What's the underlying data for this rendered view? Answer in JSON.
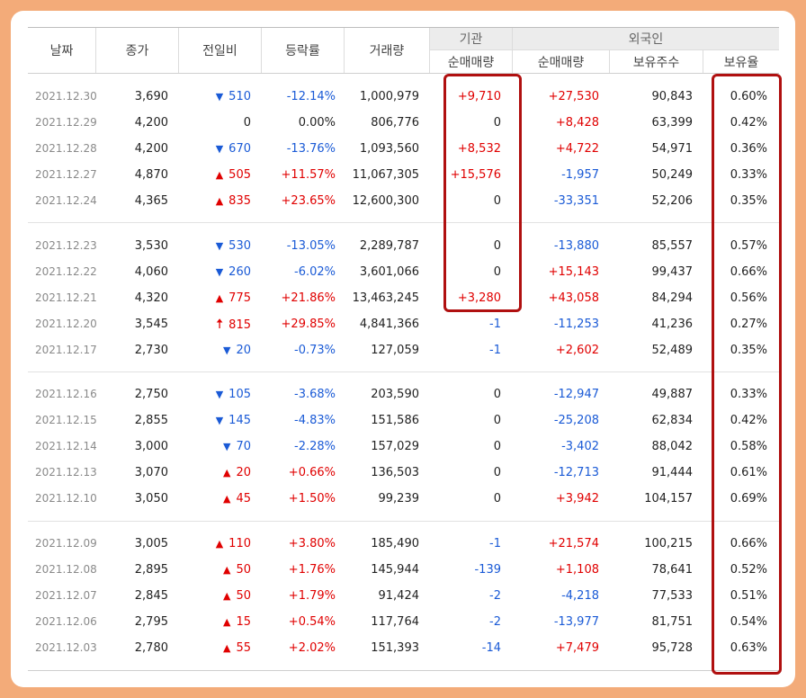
{
  "headers": {
    "date": "날짜",
    "close": "종가",
    "change": "전일비",
    "rate": "등락률",
    "volume": "거래량",
    "institution": "기관",
    "foreigner": "외국인",
    "inst_net": "순매매량",
    "foreign_net": "순매매량",
    "foreign_holdings": "보유주수",
    "foreign_ratio": "보유율"
  },
  "colors": {
    "up": "#e00000",
    "down": "#1a5ad6",
    "highlight": "#b01010",
    "frame": "#f3ab79"
  },
  "rows": [
    {
      "date": "2021.12.30",
      "close": "3,690",
      "dir": "down",
      "change": "510",
      "rate": "-12.14%",
      "volume": "1,000,979",
      "inst": "+9,710",
      "fnet": "+27,530",
      "fhold": "90,843",
      "fratio": "0.60%"
    },
    {
      "date": "2021.12.29",
      "close": "4,200",
      "dir": "none",
      "change": "0",
      "rate": "0.00%",
      "volume": "806,776",
      "inst": "0",
      "fnet": "+8,428",
      "fhold": "63,399",
      "fratio": "0.42%"
    },
    {
      "date": "2021.12.28",
      "close": "4,200",
      "dir": "down",
      "change": "670",
      "rate": "-13.76%",
      "volume": "1,093,560",
      "inst": "+8,532",
      "fnet": "+4,722",
      "fhold": "54,971",
      "fratio": "0.36%"
    },
    {
      "date": "2021.12.27",
      "close": "4,870",
      "dir": "up",
      "change": "505",
      "rate": "+11.57%",
      "volume": "11,067,305",
      "inst": "+15,576",
      "fnet": "-1,957",
      "fhold": "50,249",
      "fratio": "0.33%"
    },
    {
      "date": "2021.12.24",
      "close": "4,365",
      "dir": "up",
      "change": "835",
      "rate": "+23.65%",
      "volume": "12,600,300",
      "inst": "0",
      "fnet": "-33,351",
      "fhold": "52,206",
      "fratio": "0.35%"
    },
    {
      "date": "2021.12.23",
      "close": "3,530",
      "dir": "down",
      "change": "530",
      "rate": "-13.05%",
      "volume": "2,289,787",
      "inst": "0",
      "fnet": "-13,880",
      "fhold": "85,557",
      "fratio": "0.57%"
    },
    {
      "date": "2021.12.22",
      "close": "4,060",
      "dir": "down",
      "change": "260",
      "rate": "-6.02%",
      "volume": "3,601,066",
      "inst": "0",
      "fnet": "+15,143",
      "fhold": "99,437",
      "fratio": "0.66%"
    },
    {
      "date": "2021.12.21",
      "close": "4,320",
      "dir": "up",
      "change": "775",
      "rate": "+21.86%",
      "volume": "13,463,245",
      "inst": "+3,280",
      "fnet": "+43,058",
      "fhold": "84,294",
      "fratio": "0.56%"
    },
    {
      "date": "2021.12.20",
      "close": "3,545",
      "dir": "upper",
      "change": "815",
      "rate": "+29.85%",
      "volume": "4,841,366",
      "inst": "-1",
      "fnet": "-11,253",
      "fhold": "41,236",
      "fratio": "0.27%"
    },
    {
      "date": "2021.12.17",
      "close": "2,730",
      "dir": "down",
      "change": "20",
      "rate": "-0.73%",
      "volume": "127,059",
      "inst": "-1",
      "fnet": "+2,602",
      "fhold": "52,489",
      "fratio": "0.35%"
    },
    {
      "date": "2021.12.16",
      "close": "2,750",
      "dir": "down",
      "change": "105",
      "rate": "-3.68%",
      "volume": "203,590",
      "inst": "0",
      "fnet": "-12,947",
      "fhold": "49,887",
      "fratio": "0.33%"
    },
    {
      "date": "2021.12.15",
      "close": "2,855",
      "dir": "down",
      "change": "145",
      "rate": "-4.83%",
      "volume": "151,586",
      "inst": "0",
      "fnet": "-25,208",
      "fhold": "62,834",
      "fratio": "0.42%"
    },
    {
      "date": "2021.12.14",
      "close": "3,000",
      "dir": "down",
      "change": "70",
      "rate": "-2.28%",
      "volume": "157,029",
      "inst": "0",
      "fnet": "-3,402",
      "fhold": "88,042",
      "fratio": "0.58%"
    },
    {
      "date": "2021.12.13",
      "close": "3,070",
      "dir": "up",
      "change": "20",
      "rate": "+0.66%",
      "volume": "136,503",
      "inst": "0",
      "fnet": "-12,713",
      "fhold": "91,444",
      "fratio": "0.61%"
    },
    {
      "date": "2021.12.10",
      "close": "3,050",
      "dir": "up",
      "change": "45",
      "rate": "+1.50%",
      "volume": "99,239",
      "inst": "0",
      "fnet": "+3,942",
      "fhold": "104,157",
      "fratio": "0.69%"
    },
    {
      "date": "2021.12.09",
      "close": "3,005",
      "dir": "up",
      "change": "110",
      "rate": "+3.80%",
      "volume": "185,490",
      "inst": "-1",
      "fnet": "+21,574",
      "fhold": "100,215",
      "fratio": "0.66%"
    },
    {
      "date": "2021.12.08",
      "close": "2,895",
      "dir": "up",
      "change": "50",
      "rate": "+1.76%",
      "volume": "145,944",
      "inst": "-139",
      "fnet": "+1,108",
      "fhold": "78,641",
      "fratio": "0.52%"
    },
    {
      "date": "2021.12.07",
      "close": "2,845",
      "dir": "up",
      "change": "50",
      "rate": "+1.79%",
      "volume": "91,424",
      "inst": "-2",
      "fnet": "-4,218",
      "fhold": "77,533",
      "fratio": "0.51%"
    },
    {
      "date": "2021.12.06",
      "close": "2,795",
      "dir": "up",
      "change": "15",
      "rate": "+0.54%",
      "volume": "117,764",
      "inst": "-2",
      "fnet": "-13,977",
      "fhold": "81,751",
      "fratio": "0.54%"
    },
    {
      "date": "2021.12.03",
      "close": "2,780",
      "dir": "up",
      "change": "55",
      "rate": "+2.02%",
      "volume": "151,393",
      "inst": "-14",
      "fnet": "+7,479",
      "fhold": "95,728",
      "fratio": "0.63%"
    }
  ]
}
